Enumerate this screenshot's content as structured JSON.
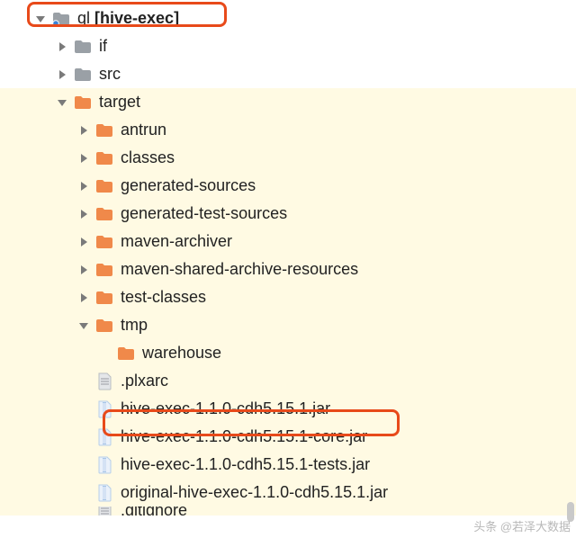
{
  "colors": {
    "folder_orange": "#f0894a",
    "folder_grey": "#9aa0a6",
    "folder_blue_dot": "#3b82d6",
    "arrow": "#7a7a7a",
    "jar": "#a9c6e8",
    "file": "#9aa0a6",
    "highlight": "#e84a1a"
  },
  "tree": {
    "root": {
      "name": "ql",
      "module": "[hive-exec]"
    },
    "children_level1": [
      {
        "label": "if",
        "type": "folder-grey",
        "expanded": false
      },
      {
        "label": "src",
        "type": "folder-grey",
        "expanded": false
      },
      {
        "label": "target",
        "type": "folder-orange",
        "expanded": true
      }
    ],
    "target_children": [
      {
        "label": "antrun",
        "type": "folder-orange",
        "expanded": false
      },
      {
        "label": "classes",
        "type": "folder-orange",
        "expanded": false
      },
      {
        "label": "generated-sources",
        "type": "folder-orange",
        "expanded": false
      },
      {
        "label": "generated-test-sources",
        "type": "folder-orange",
        "expanded": false
      },
      {
        "label": "maven-archiver",
        "type": "folder-orange",
        "expanded": false
      },
      {
        "label": "maven-shared-archive-resources",
        "type": "folder-orange",
        "expanded": false
      },
      {
        "label": "test-classes",
        "type": "folder-orange",
        "expanded": false
      },
      {
        "label": "tmp",
        "type": "folder-orange",
        "expanded": true,
        "children": [
          {
            "label": "warehouse",
            "type": "folder-orange",
            "expanded": false,
            "noarrow": true
          }
        ]
      },
      {
        "label": ".plxarc",
        "type": "file",
        "noarrow": true
      },
      {
        "label": "hive-exec-1.1.0-cdh5.15.1.jar",
        "type": "jar",
        "noarrow": true
      },
      {
        "label": "hive-exec-1.1.0-cdh5.15.1-core.jar",
        "type": "jar",
        "noarrow": true
      },
      {
        "label": "hive-exec-1.1.0-cdh5.15.1-tests.jar",
        "type": "jar",
        "noarrow": true
      },
      {
        "label": "original-hive-exec-1.1.0-cdh5.15.1.jar",
        "type": "jar",
        "noarrow": true
      },
      {
        "label": ".gitignore",
        "type": "file",
        "noarrow": true,
        "cut": true
      }
    ]
  },
  "watermark": "头条 @若泽大数据"
}
